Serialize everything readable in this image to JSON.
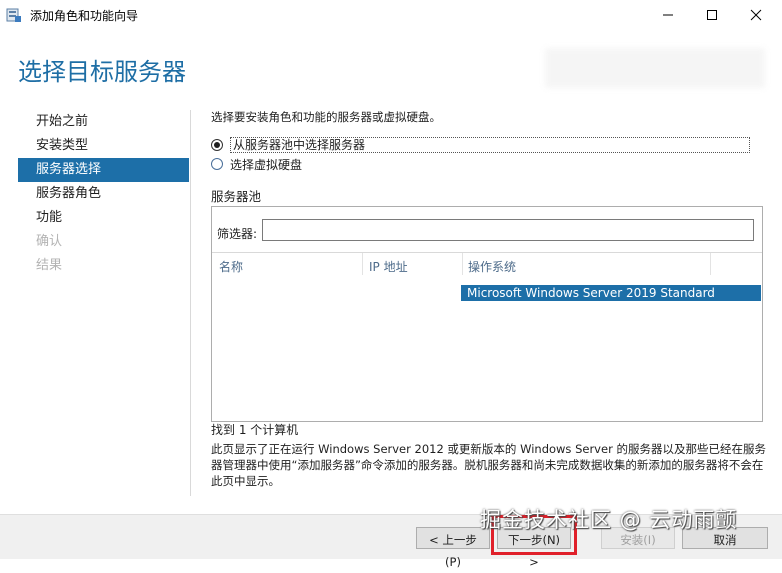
{
  "window": {
    "title": "添加角色和功能向导",
    "controls": {
      "minimize_icon": "minimize-icon",
      "maximize_icon": "maximize-icon",
      "close_icon": "close-icon"
    }
  },
  "page_title": "选择目标服务器",
  "nav": {
    "items": [
      {
        "label": "开始之前",
        "state": "normal"
      },
      {
        "label": "安装类型",
        "state": "normal"
      },
      {
        "label": "服务器选择",
        "state": "active"
      },
      {
        "label": "服务器角色",
        "state": "normal"
      },
      {
        "label": "功能",
        "state": "normal"
      },
      {
        "label": "确认",
        "state": "disabled"
      },
      {
        "label": "结果",
        "state": "disabled"
      }
    ]
  },
  "main": {
    "description": "选择要安装角色和功能的服务器或虚拟硬盘。",
    "options": [
      {
        "label": "从服务器池中选择服务器",
        "checked": true
      },
      {
        "label": "选择虚拟硬盘",
        "checked": false
      }
    ],
    "pool": {
      "label": "服务器池",
      "filter_label": "筛选器:",
      "filter_value": "",
      "columns": [
        "名称",
        "IP 地址",
        "操作系统"
      ],
      "rows": [
        {
          "name": "",
          "ip": "",
          "os": "Microsoft Windows Server 2019 Standard",
          "selected": true
        }
      ]
    },
    "found_text": "找到 1 个计算机",
    "info_text": "此页显示了正在运行 Windows Server 2012 或更新版本的 Windows Server 的服务器以及那些已经在服务器管理器中使用“添加服务器”命令添加的服务器。脱机服务器和尚未完成数据收集的新添加的服务器将不会在此页中显示。"
  },
  "footer": {
    "prev_label": "< 上一步(P)",
    "next_label": "下一步(N) >",
    "install_label": "安装(I)",
    "cancel_label": "取消",
    "install_enabled": false
  },
  "watermark": "掘金技术社区 @ 云动雨颤",
  "colors": {
    "accent": "#1d6fa8",
    "title": "#1e6ea5",
    "highlight": "#e0202a"
  }
}
